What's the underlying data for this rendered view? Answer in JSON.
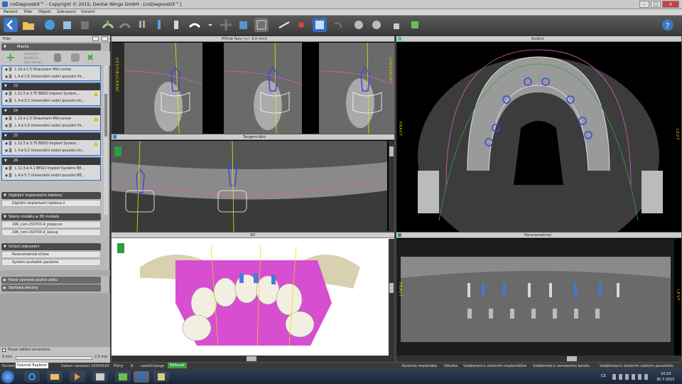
{
  "window": {
    "title": "coDiagnostiX™ - Copyright © 2015, Dental Wings GmbH - [coDiagnostiX™]"
  },
  "menu": [
    "Pacient",
    "Plán",
    "Objekt",
    "Zobrazení",
    "Ostatní"
  ],
  "left_panel": {
    "header": "Plán",
    "subheader": "Maxila",
    "toolbar_labels": [
      "Implantát...",
      "Vodičícch...",
      "Sam-movan."
    ],
    "implants": [
      {
        "number": "",
        "rows": [
          {
            "text": "L 10  ø 1.5  Straumann Mini-screw",
            "warn": false
          },
          {
            "text": "L 4  ø 1.6  Univerzální vodicí pouzdro Vir...",
            "warn": false
          }
        ]
      },
      {
        "number": "23",
        "rows": [
          {
            "text": "L 11.5  ø 3.75  BEGO Implant System...",
            "warn": true
          },
          {
            "text": "L 4  ø 5.2  Univerzální vodicí pouzdro Un...",
            "warn": false
          }
        ]
      },
      {
        "number": "24",
        "rows": [
          {
            "text": "L 10  ø 1.5  Straumann Mini-screw",
            "warn": true
          },
          {
            "text": "L 4  ø 1.6  Univerzální vodicí pouzdro Vir...",
            "warn": false
          }
        ]
      },
      {
        "number": "25",
        "rows": [
          {
            "text": "L 11.5  ø 3.75  BEGO Implant System...",
            "warn": true
          },
          {
            "text": "L 4  ø 5.2  Univerzální vodicí pouzdro Un...",
            "warn": false
          }
        ]
      },
      {
        "number": "26",
        "rows": [
          {
            "text": "L 11.5  ø 4.1  BEGO Implant Systems BE...",
            "warn": false
          },
          {
            "text": "L 4  ø 5.7  Univerzální vodicí pouzdro BE...",
            "warn": false
          }
        ]
      }
    ],
    "sections": {
      "templates": {
        "title": "Digitální implantační šablony",
        "items": [
          "Digitální implantační šablona 2"
        ]
      },
      "models": {
        "title": "Skeny modelu a 3D modely",
        "items": [
          "196_com-150703-4_prepscan",
          "196_com-150703-4_waxup"
        ]
      },
      "display": {
        "title": "Určení zobrazení",
        "items": [
          "Panoramatická křivka",
          "Systém souřadnic pacienta"
        ]
      },
      "collapsed": [
        "Nová vybraná pozice zubu",
        "Staříská denzity"
      ]
    },
    "footer": {
      "checkbox": "Pouze měření ohraničení",
      "min": "0 mm",
      "max": "2.5 mm"
    }
  },
  "viewports": {
    "cross": {
      "title": "Příčné řezy (+/- 3.0 mm)",
      "side_left": "VESTIBULÁRNÍ",
      "side_right": "LINGVÁLNÍ"
    },
    "tangential": {
      "title": "Tangenciální"
    },
    "axial": {
      "title": "Axiální",
      "side_left": "PRAVÝ",
      "side_right": "LEVÝ"
    },
    "three_d": {
      "title": "3D"
    },
    "panoramic": {
      "title": "Panoramatický",
      "side_left": "PRAVÝ",
      "side_right": "LEVÝ"
    }
  },
  "status": {
    "patient_label": "Pacient",
    "patient_value": "Internet Explorer",
    "date_label": "Datum narození",
    "date_value": "19560520",
    "plans_label": "Plány",
    "plans_value": "8",
    "exchange_label": "caseXchange",
    "exchange_value": "Editovat",
    "control": "Kontrola implantátu",
    "d1": "Denzita",
    "d2": "Vzdálenost k ostatním implantátům",
    "d3": "Vzdálenost k nervovemu kanálu",
    "d4": "Vzdálenost k ostatním vodicím pouzdrům"
  },
  "taskbar": {
    "lang": "CS",
    "time": "10:10",
    "date": "30.7.2015"
  }
}
